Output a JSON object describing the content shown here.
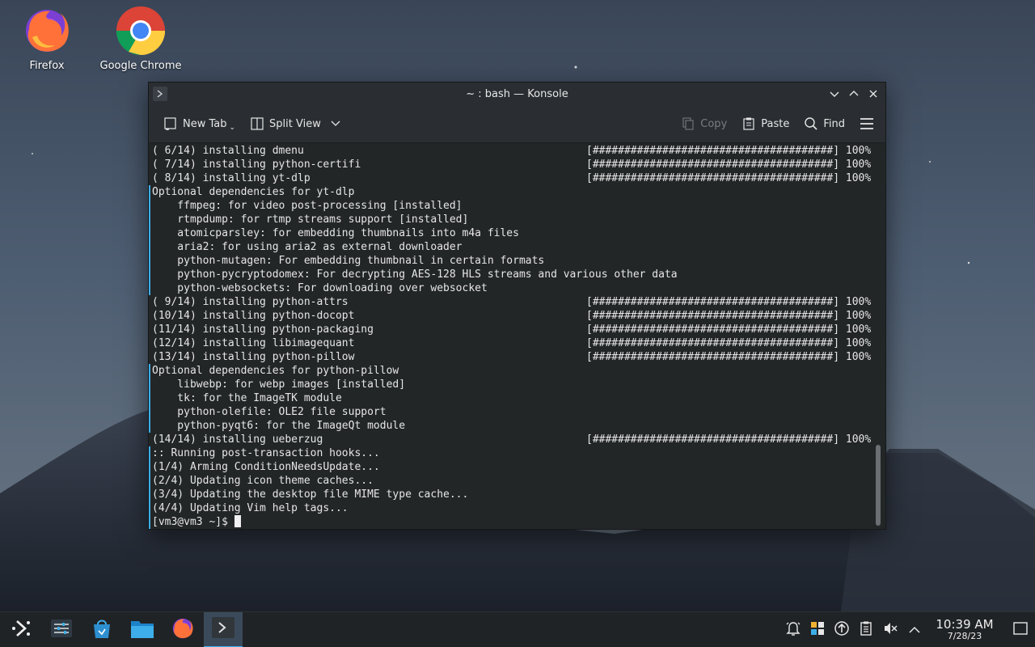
{
  "desktop": {
    "icons": [
      {
        "label": "Firefox",
        "icon": "firefox-icon"
      },
      {
        "label": "Google Chrome",
        "icon": "chrome-icon"
      }
    ]
  },
  "window": {
    "title": "~ : bash — Konsole",
    "toolbar": {
      "new_tab": "New Tab",
      "split_view": "Split View",
      "copy": "Copy",
      "paste": "Paste",
      "find": "Find"
    }
  },
  "terminal": {
    "lines": [
      {
        "text": "( 6/14) installing dmenu",
        "progress": "[######################################] 100%"
      },
      {
        "text": "( 7/14) installing python-certifi",
        "progress": "[######################################] 100%"
      },
      {
        "text": "( 8/14) installing yt-dlp",
        "progress": "[######################################] 100%"
      },
      {
        "text": "Optional dependencies for yt-dlp"
      },
      {
        "text": "    ffmpeg: for video post-processing [installed]"
      },
      {
        "text": "    rtmpdump: for rtmp streams support [installed]"
      },
      {
        "text": "    atomicparsley: for embedding thumbnails into m4a files"
      },
      {
        "text": "    aria2: for using aria2 as external downloader"
      },
      {
        "text": "    python-mutagen: For embedding thumbnail in certain formats"
      },
      {
        "text": "    python-pycryptodomex: For decrypting AES-128 HLS streams and various other data"
      },
      {
        "text": "    python-websockets: For downloading over websocket"
      },
      {
        "text": "( 9/14) installing python-attrs",
        "progress": "[######################################] 100%"
      },
      {
        "text": "(10/14) installing python-docopt",
        "progress": "[######################################] 100%"
      },
      {
        "text": "(11/14) installing python-packaging",
        "progress": "[######################################] 100%"
      },
      {
        "text": "(12/14) installing libimagequant",
        "progress": "[######################################] 100%"
      },
      {
        "text": "(13/14) installing python-pillow",
        "progress": "[######################################] 100%"
      },
      {
        "text": "Optional dependencies for python-pillow"
      },
      {
        "text": "    libwebp: for webp images [installed]"
      },
      {
        "text": "    tk: for the ImageTK module"
      },
      {
        "text": "    python-olefile: OLE2 file support"
      },
      {
        "text": "    python-pyqt6: for the ImageQt module"
      },
      {
        "text": "(14/14) installing ueberzug",
        "progress": "[######################################] 100%"
      },
      {
        "text": ":: Running post-transaction hooks..."
      },
      {
        "text": "(1/4) Arming ConditionNeedsUpdate..."
      },
      {
        "text": "(2/4) Updating icon theme caches..."
      },
      {
        "text": "(3/4) Updating the desktop file MIME type cache..."
      },
      {
        "text": "(4/4) Updating Vim help tags..."
      }
    ],
    "prompt": "[vm3@vm3 ~]$ "
  },
  "taskbar": {
    "clock": {
      "time": "10:39 AM",
      "date": "7/28/23"
    }
  },
  "colors": {
    "accent": "#3daee9",
    "terminal_bg": "#232627",
    "chrome_bg": "#2a2e32"
  }
}
